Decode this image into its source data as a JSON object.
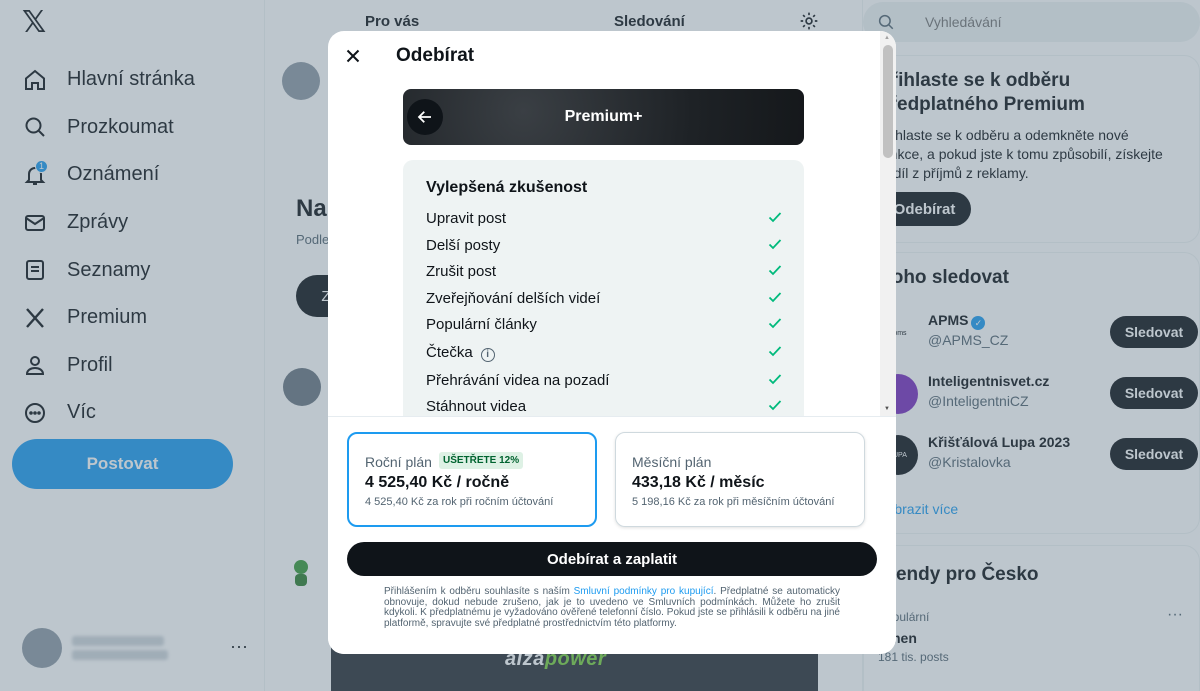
{
  "sidebar": {
    "logo": "𝕏",
    "items": [
      {
        "label": "Hlavní stránka",
        "icon": "home-icon"
      },
      {
        "label": "Prozkoumat",
        "icon": "search-icon"
      },
      {
        "label": "Oznámení",
        "icon": "bell-icon",
        "badge": "1"
      },
      {
        "label": "Zprávy",
        "icon": "mail-icon"
      },
      {
        "label": "Seznamy",
        "icon": "list-icon"
      },
      {
        "label": "Premium",
        "icon": "x-logo-icon"
      },
      {
        "label": "Profil",
        "icon": "person-icon"
      },
      {
        "label": "Víc",
        "icon": "more-circle-icon"
      }
    ],
    "post_label": "Postovat",
    "account_more": "···"
  },
  "feed": {
    "tabs": [
      "Pro vás",
      "Sledování"
    ],
    "promo_title": "Na",
    "promo_sub": "Podle",
    "promo_button": "Z",
    "ad_text_main": "alza",
    "ad_text_accent": "power"
  },
  "right": {
    "search_placeholder": "Vyhledávání",
    "premium_card": {
      "title": "Přihlaste se k odběru předplatného Premium",
      "description": "Přihlaste se k odběru a odemkněte nové funkce, a pokud jste k tomu způsobilí, získejte podíl z příjmů z reklamy.",
      "button": "Odebírat"
    },
    "follow_card": {
      "title": "Koho sledovat",
      "accounts": [
        {
          "name": "APMS",
          "handle": "@APMS_CZ",
          "avatar_text": "apms",
          "verified": true
        },
        {
          "name": "Inteligentnisvet.cz",
          "handle": "@InteligentniCZ",
          "avatar_text": "",
          "verified": false
        },
        {
          "name": "Křišťálová Lupa 2023",
          "handle": "@Kristalovka",
          "avatar_text": "LUPA",
          "verified": false
        }
      ],
      "follow_label": "Sledovat",
      "show_more": "Zobrazit více"
    },
    "trends_card": {
      "title": "Trendy pro Česko",
      "trend_meta": "Populární",
      "trend_name": "Amen",
      "trend_count": "181 tis. posts",
      "more": "···"
    }
  },
  "modal": {
    "title": "Odebírat",
    "tier_name": "Premium+",
    "features_title": "Vylepšená zkušenost",
    "features": [
      {
        "label": "Upravit post",
        "info": false
      },
      {
        "label": "Delší posty",
        "info": false
      },
      {
        "label": "Zrušit post",
        "info": false
      },
      {
        "label": "Zveřejňování delších videí",
        "info": false
      },
      {
        "label": "Populární články",
        "info": false
      },
      {
        "label": "Čtečka",
        "info": true
      },
      {
        "label": "Přehrávání videa na pozadí",
        "info": false
      },
      {
        "label": "Stáhnout videa",
        "info": false
      }
    ],
    "plans": {
      "annual": {
        "name": "Roční plán",
        "badge": "UŠETŘETE 12%",
        "price": "4 525,40 Kč / ročně",
        "detail": "4 525,40 Kč za rok při ročním účtování",
        "selected": true
      },
      "monthly": {
        "name": "Měsíční plán",
        "price": "433,18 Kč / měsíc",
        "detail": "5 198,16 Kč za rok při měsíčním účtování",
        "selected": false
      }
    },
    "pay_button": "Odebírat a zaplatit",
    "legal_before": "Přihlášením k odběru souhlasíte s naším ",
    "legal_link": "Smluvní podmínky pro kupující",
    "legal_after": ". Předplatné se automaticky obnovuje, dokud nebude zrušeno, jak je to uvedeno ve Smluvních podmínkách. Můžete ho zrušit kdykoli. K předplatnému je vyžadováno ověřené telefonní číslo. Pokud jste se přihlásili k odběru na jiné platformě, spravujte své předplatné prostřednictvím této platformy."
  },
  "colors": {
    "accent": "#1d9bf0",
    "dark": "#0f1419",
    "check": "#00ba7c",
    "savings_bg": "#def1e5"
  }
}
